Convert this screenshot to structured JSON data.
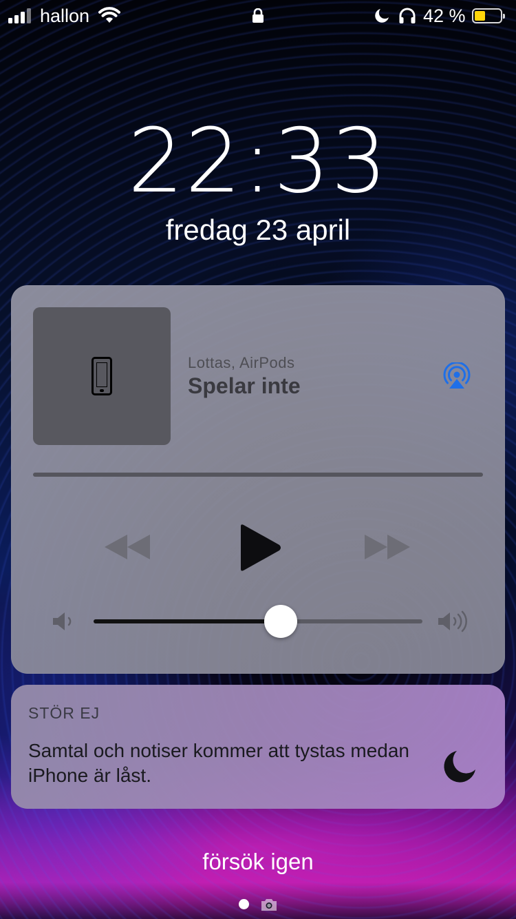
{
  "status_bar": {
    "carrier": "hallon",
    "battery_percent_label": "42 %",
    "battery_level": 0.42,
    "battery_color": "#ffd60a",
    "icons": [
      "signal-icon",
      "wifi-icon",
      "lock-icon",
      "moon-icon",
      "headphones-icon",
      "battery-icon"
    ]
  },
  "lock_screen": {
    "time": "22:33",
    "date": "fredag 23 april"
  },
  "media_player": {
    "route": "Lottas, AirPods",
    "state": "Spelar inte",
    "artwork_icon": "iphone-icon",
    "airplay_color": "#1e6fe8",
    "volume_level": 0.57,
    "controls": [
      "rewind-icon",
      "play-icon",
      "fast-forward-icon"
    ]
  },
  "notification": {
    "title": "STÖR EJ",
    "body": "Samtal och notiser kommer att tystas medan iPhone är låst.",
    "icon": "moon-icon"
  },
  "footer": {
    "retry_label": "försök igen",
    "icons": [
      "page-dot",
      "camera-icon"
    ]
  }
}
